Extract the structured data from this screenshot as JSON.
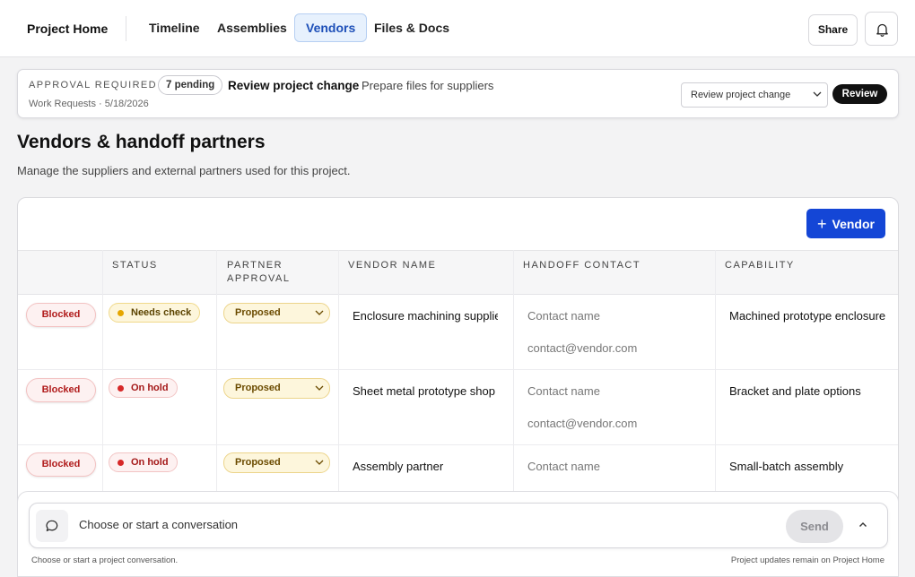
{
  "nav": {
    "brand": "Project Home",
    "tabs": [
      {
        "label": "Timeline"
      },
      {
        "label": "Assemblies"
      },
      {
        "label": "Vendors"
      },
      {
        "label": "Files & Docs"
      }
    ],
    "active_tab": "Vendors",
    "share_label": "Share",
    "bell_icon": "bell-icon"
  },
  "approval": {
    "kicker": "APPROVAL REQUIRED",
    "pending": "7 pending",
    "title": "Review project change",
    "subtitle": "Prepare files for suppliers",
    "meta": "Work Requests · 5/18/2026",
    "select_value": "Review project change",
    "review_label": "Review"
  },
  "page": {
    "title": "Vendors & handoff partners",
    "description": "Manage the suppliers and external partners used for this project."
  },
  "table": {
    "add_label": "Vendor",
    "columns": [
      "",
      "STATUS",
      "PARTNER APPROVAL",
      "VENDOR NAME",
      "HANDOFF CONTACT",
      "CAPABILITY"
    ],
    "column_lines": {
      "partner_approval": [
        "PARTNER",
        "APPROVAL"
      ]
    },
    "rows": [
      {
        "flag": "Blocked",
        "status": "Needs check",
        "status_kind": "check",
        "partner_approval": "Proposed",
        "vendor_name": "Enclosure machining supplier",
        "contact_name": "Contact name",
        "contact_email": "contact@vendor.com",
        "capability": "Machined prototype enclosure"
      },
      {
        "flag": "Blocked",
        "status": "On hold",
        "status_kind": "hold",
        "partner_approval": "Proposed",
        "vendor_name": "Sheet metal prototype shop",
        "contact_name": "Contact name",
        "contact_email": "contact@vendor.com",
        "capability": "Bracket and plate options"
      },
      {
        "flag": "Blocked",
        "status": "On hold",
        "status_kind": "hold",
        "partner_approval": "Proposed",
        "vendor_name": "Assembly partner",
        "contact_name": "Contact name",
        "contact_email": "",
        "capability": "Small-batch assembly"
      }
    ]
  },
  "conversation": {
    "placeholder": "Choose or start a conversation",
    "send_label": "Send",
    "footer_left": "Choose or start a project conversation.",
    "footer_right": "Project updates remain on Project Home"
  },
  "colors": {
    "accent": "#1446d6",
    "blocked": "#b11d1d",
    "needs_check": "#e5a600",
    "on_hold": "#d62828"
  }
}
